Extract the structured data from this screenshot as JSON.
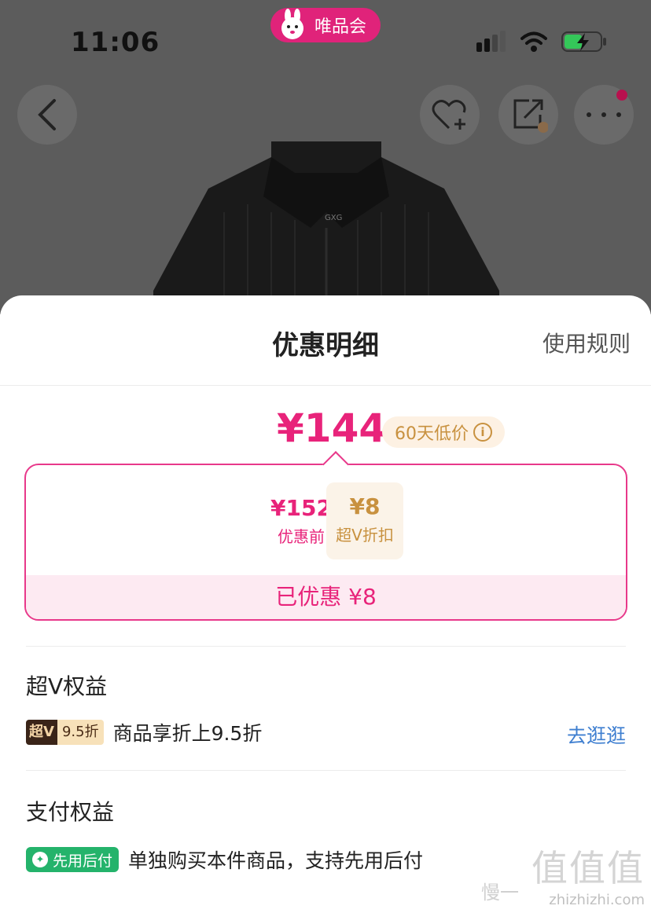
{
  "status_bar": {
    "time": "11:06",
    "app_name": "唯品会"
  },
  "nav": {
    "back_icon": "chevron-left-icon",
    "favorite_icon": "heart-plus-icon",
    "share_icon": "share-icon",
    "more_icon": "more-dots-icon"
  },
  "product": {
    "brand_label": "GXG"
  },
  "sheet": {
    "title": "优惠明细",
    "rules_link": "使用规则",
    "final_price": "¥144",
    "low_price_badge": "60天低价",
    "calc": {
      "before_value": "¥152",
      "before_label": "优惠前",
      "operator": "-",
      "discount_value": "¥8",
      "discount_label": "超V折扣",
      "saved_text": "已优惠 ¥8"
    },
    "sv_section": {
      "title": "超V权益",
      "tag_left": "超V",
      "tag_right": "9.5折",
      "text": "商品享折上9.5折",
      "link": "去逛逛"
    },
    "pay_section": {
      "title": "支付权益",
      "tag": "先用后付",
      "text": "单独购买本件商品，支持先用后付"
    }
  },
  "watermark": {
    "big": "值值值",
    "small": "zhizhizhi.com",
    "left_text": "慢一"
  },
  "colors": {
    "accent": "#e8237a",
    "gold": "#c8913f",
    "link": "#3f7fd0",
    "green": "#24b36b"
  }
}
